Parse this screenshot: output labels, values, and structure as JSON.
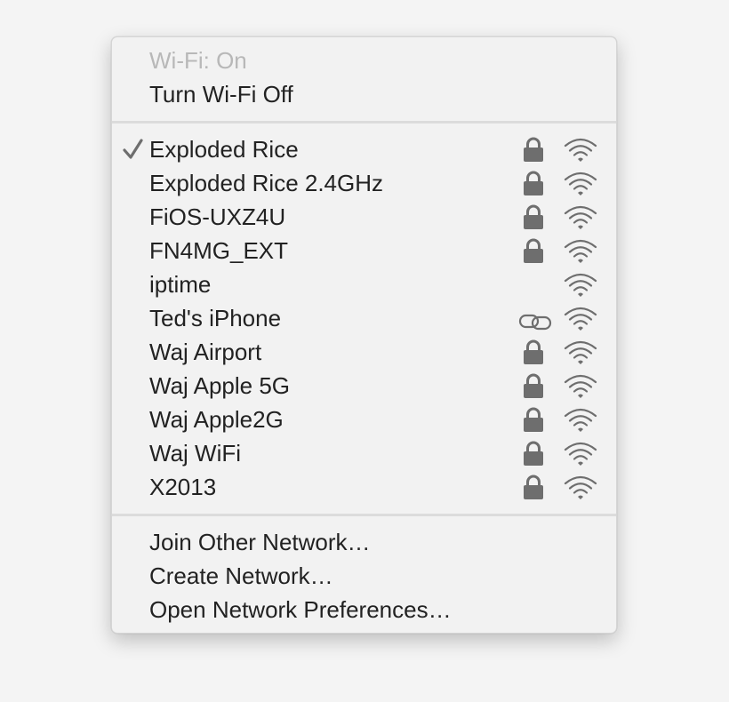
{
  "menu": {
    "status_label": "Wi-Fi: On",
    "toggle_label": "Turn Wi-Fi Off",
    "networks": [
      {
        "name": "Exploded Rice",
        "selected": true,
        "secured": true,
        "hotspot": false,
        "icon": "wifi-signal-icon"
      },
      {
        "name": "Exploded Rice 2.4GHz",
        "selected": false,
        "secured": true,
        "hotspot": false,
        "icon": "wifi-signal-icon"
      },
      {
        "name": "FiOS-UXZ4U",
        "selected": false,
        "secured": true,
        "hotspot": false,
        "icon": "wifi-signal-icon"
      },
      {
        "name": "FN4MG_EXT",
        "selected": false,
        "secured": true,
        "hotspot": false,
        "icon": "wifi-signal-icon"
      },
      {
        "name": "iptime",
        "selected": false,
        "secured": false,
        "hotspot": false,
        "icon": "wifi-signal-icon"
      },
      {
        "name": "Ted's iPhone",
        "selected": false,
        "secured": false,
        "hotspot": true,
        "icon": "wifi-signal-icon"
      },
      {
        "name": "Waj Airport",
        "selected": false,
        "secured": true,
        "hotspot": false,
        "icon": "wifi-signal-icon"
      },
      {
        "name": "Waj Apple 5G",
        "selected": false,
        "secured": true,
        "hotspot": false,
        "icon": "wifi-signal-icon"
      },
      {
        "name": "Waj Apple2G",
        "selected": false,
        "secured": true,
        "hotspot": false,
        "icon": "wifi-signal-icon"
      },
      {
        "name": "Waj WiFi",
        "selected": false,
        "secured": true,
        "hotspot": false,
        "icon": "wifi-signal-icon"
      },
      {
        "name": "X2013",
        "selected": false,
        "secured": true,
        "hotspot": false,
        "icon": "wifi-signal-icon"
      }
    ],
    "actions": {
      "join_other": "Join Other Network…",
      "create_network": "Create Network…",
      "open_prefs": "Open Network Preferences…"
    }
  },
  "colors": {
    "text": "#222222",
    "disabled_text": "#b8b8b8",
    "icon": "#6e6e6e",
    "menu_bg": "#f2f2f2",
    "separator": "#dcdcdc"
  }
}
